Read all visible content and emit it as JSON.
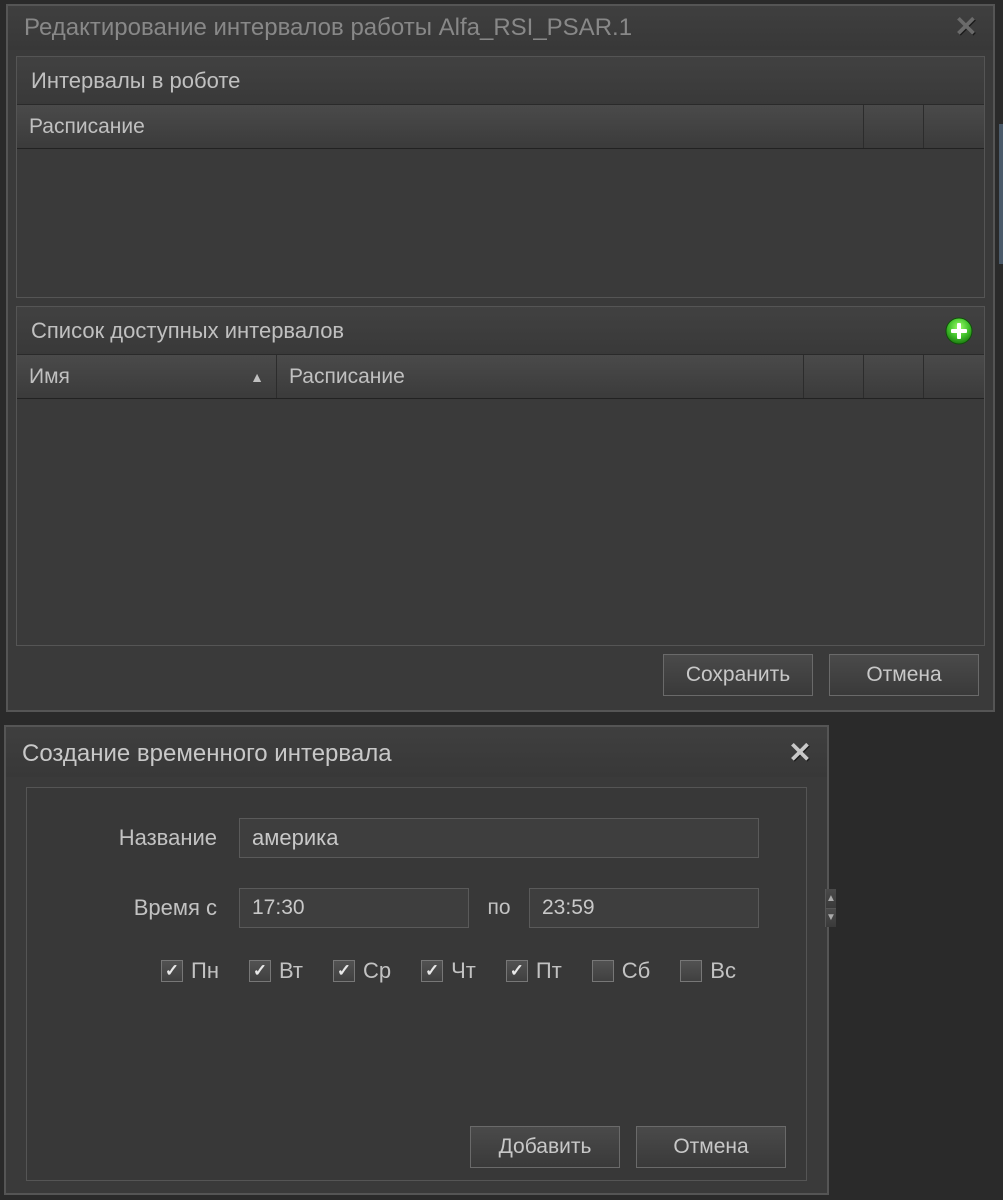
{
  "dialog1": {
    "title": "Редактирование интервалов работы Alfa_RSI_PSAR.1",
    "section_robot": "Интервалы в роботе",
    "col_schedule": "Расписание",
    "section_available": "Список доступных интервалов",
    "col_name": "Имя",
    "save": "Сохранить",
    "cancel": "Отмена"
  },
  "dialog2": {
    "title": "Создание временного интервала",
    "label_name": "Название",
    "name_value": "америка",
    "label_time_from": "Время с",
    "time_from": "17:30",
    "label_to": "по",
    "time_to": "23:59",
    "days": [
      {
        "label": "Пн",
        "checked": true
      },
      {
        "label": "Вт",
        "checked": true
      },
      {
        "label": "Ср",
        "checked": true
      },
      {
        "label": "Чт",
        "checked": true
      },
      {
        "label": "Пт",
        "checked": true
      },
      {
        "label": "Сб",
        "checked": false
      },
      {
        "label": "Вс",
        "checked": false
      }
    ],
    "add": "Добавить",
    "cancel": "Отмена"
  }
}
